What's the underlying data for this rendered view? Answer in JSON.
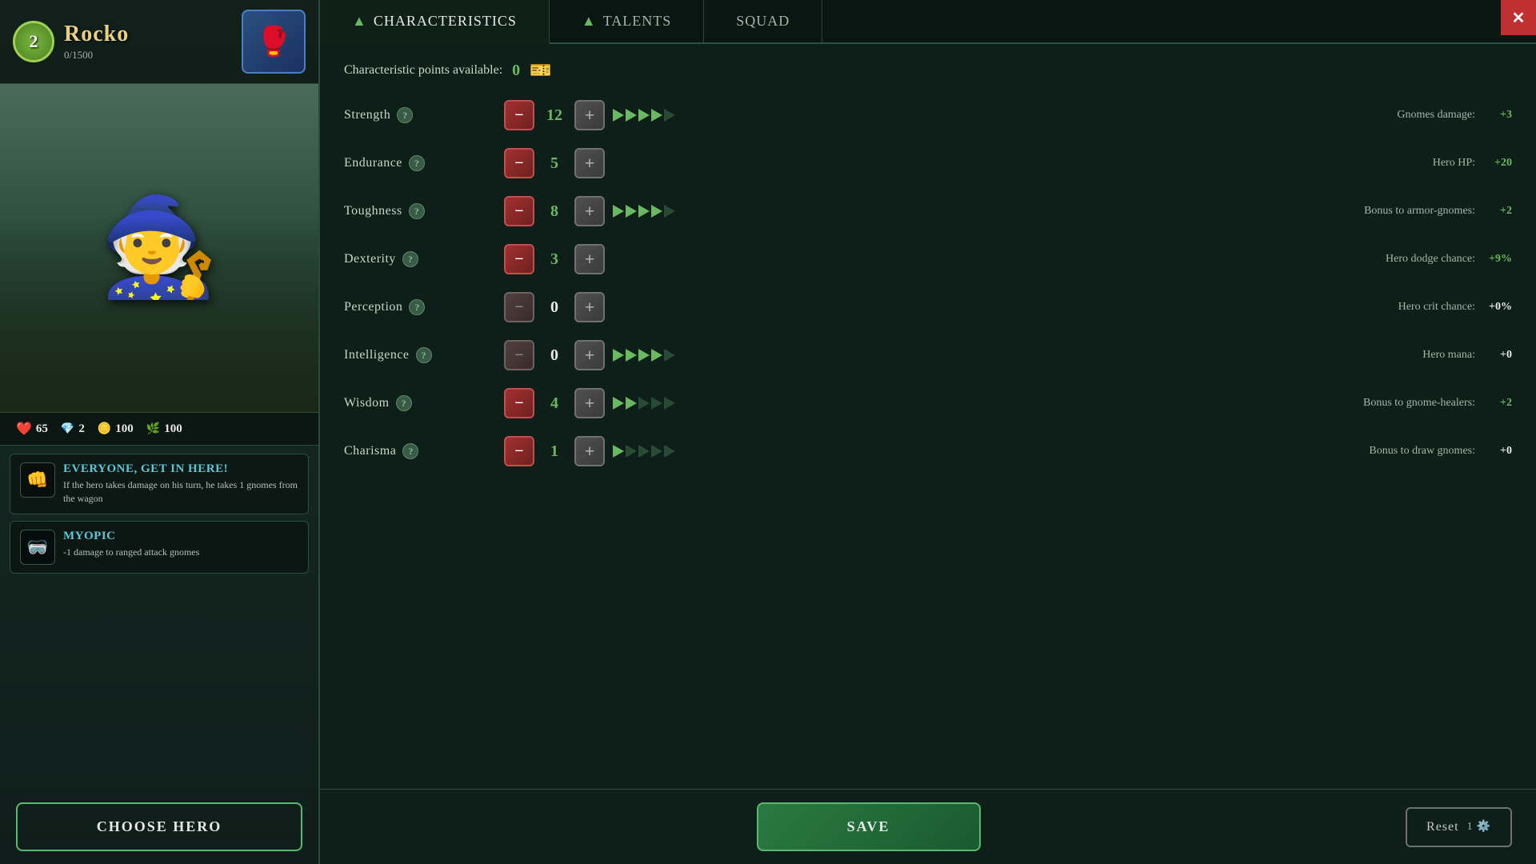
{
  "hero": {
    "level": 2,
    "name": "Rocko",
    "xp": "0/1500",
    "icon": "🥊",
    "hp": 65,
    "gems": 2,
    "gold": 100,
    "wood": 100
  },
  "tabs": [
    {
      "id": "characteristics",
      "label": "Characteristics",
      "active": true,
      "arrow": true
    },
    {
      "id": "talents",
      "label": "Talents",
      "active": false,
      "arrow": true
    },
    {
      "id": "squad",
      "label": "Squad",
      "active": false,
      "arrow": false
    }
  ],
  "points": {
    "label": "Characteristic points available:",
    "value": 0
  },
  "stats": [
    {
      "id": "strength",
      "label": "Strength",
      "value": 12,
      "minus_enabled": true,
      "arrows_filled": 4,
      "arrows_total": 5,
      "bonus_label": "Gnomes damage:",
      "bonus_value": "+3",
      "bonus_positive": true
    },
    {
      "id": "endurance",
      "label": "Endurance",
      "value": 5,
      "minus_enabled": true,
      "arrows_filled": 0,
      "arrows_total": 0,
      "bonus_label": "Hero HP:",
      "bonus_value": "+20",
      "bonus_positive": true
    },
    {
      "id": "toughness",
      "label": "Toughness",
      "value": 8,
      "minus_enabled": true,
      "arrows_filled": 4,
      "arrows_total": 5,
      "bonus_label": "Bonus to armor-gnomes:",
      "bonus_value": "+2",
      "bonus_positive": true
    },
    {
      "id": "dexterity",
      "label": "Dexterity",
      "value": 3,
      "minus_enabled": true,
      "arrows_filled": 0,
      "arrows_total": 0,
      "bonus_label": "Hero dodge chance:",
      "bonus_value": "+9%",
      "bonus_positive": true
    },
    {
      "id": "perception",
      "label": "Perception",
      "value": 0,
      "minus_enabled": false,
      "arrows_filled": 0,
      "arrows_total": 0,
      "bonus_label": "Hero crit chance:",
      "bonus_value": "+0%",
      "bonus_positive": false
    },
    {
      "id": "intelligence",
      "label": "Intelligence",
      "value": 0,
      "minus_enabled": false,
      "arrows_filled": 4,
      "arrows_total": 5,
      "bonus_label": "Hero mana:",
      "bonus_value": "+0",
      "bonus_positive": false
    },
    {
      "id": "wisdom",
      "label": "Wisdom",
      "value": 4,
      "minus_enabled": true,
      "arrows_filled": 2,
      "arrows_total": 5,
      "bonus_label": "Bonus to gnome-healers:",
      "bonus_value": "+2",
      "bonus_positive": true
    },
    {
      "id": "charisma",
      "label": "Charisma",
      "value": 1,
      "minus_enabled": true,
      "arrows_filled": 1,
      "arrows_total": 5,
      "bonus_label": "Bonus to draw gnomes:",
      "bonus_value": "+0",
      "bonus_positive": false
    }
  ],
  "traits": [
    {
      "id": "everyone-get-in-here",
      "icon": "👊",
      "title": "Everyone, get in here!",
      "desc": "If the hero takes damage on his turn, he takes 1 gnomes from the wagon"
    },
    {
      "id": "myopic",
      "icon": "🥽",
      "title": "Myopic",
      "desc": "-1 damage to ranged attack gnomes"
    }
  ],
  "buttons": {
    "choose_hero": "Choose Hero",
    "save": "Save",
    "reset": "Reset",
    "reset_count": 1
  }
}
